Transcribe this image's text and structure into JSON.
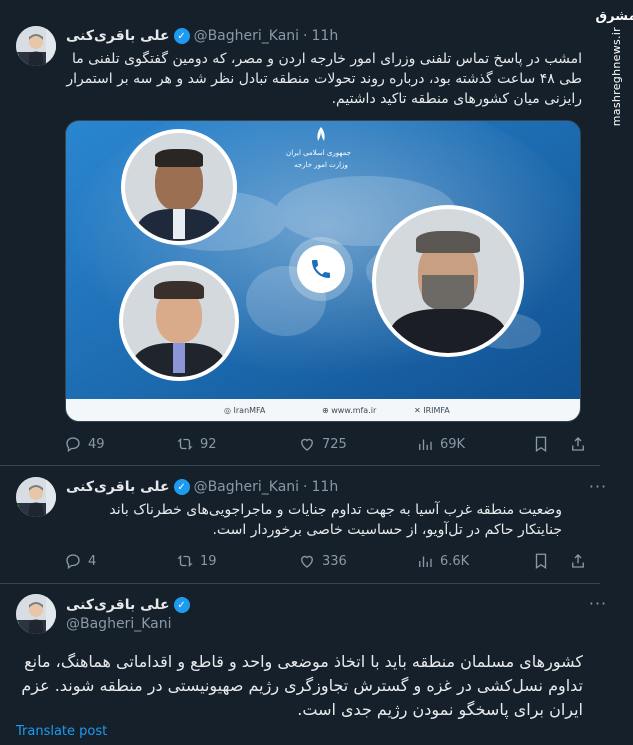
{
  "brand": {
    "logo": "مشرق",
    "url": "mashreghnews.ir"
  },
  "tweets": [
    {
      "name": "علی باقری‌کنی",
      "handle": "@Bagheri_Kani",
      "time": "11h",
      "text": "امشب در پاسخ تماس تلفنی وزرای امور خارجه اردن و مصر، که دومین گفتگوی تلفنی ما طی ۴۸ ساعت گذشته بود، درباره روند تحولات منطقه تبادل نظر شد و هر سه بر استمرار رایزنی میان کشورهای منطقه تاکید داشتیم.",
      "media": {
        "ministry_line1": "جمهوری اسلامی ایران",
        "ministry_line2": "وزارت امور خارجه",
        "footer_left": "IranMFA",
        "footer_mid": "www.mfa.ir",
        "footer_right": "IRIMFA"
      },
      "stats": {
        "replies": "49",
        "reposts": "92",
        "likes": "725",
        "views": "69K"
      }
    },
    {
      "name": "علی باقری‌کنی",
      "handle": "@Bagheri_Kani",
      "time": "11h",
      "text": "وضعیت منطقه غرب آسیا به جهت تداوم جنایات و ماجراجویی‌های خطرناک باند جنایتکار حاکم در تل‌آویو، از حساسیت خاصی برخوردار است.",
      "stats": {
        "replies": "4",
        "reposts": "19",
        "likes": "336",
        "views": "6.6K"
      }
    },
    {
      "name": "علی باقری‌کنی",
      "handle": "@Bagheri_Kani",
      "text": "کشورهای مسلمان منطقه باید با اتخاذ موضعی واحد و قاطع و اقداماتی هماهنگ، مانع تداوم نسل‌کشی در غزه و گسترش تجاوزگری رژیم صهیونیستی در منطقه شوند. عزم ایران برای پاسخگو نمودن رژیم جدی است.",
      "translate": "Translate post"
    }
  ],
  "colors": {
    "background": "#15202b",
    "accent": "#1d9bf0",
    "muted": "#8b98a5",
    "border": "#38444d"
  },
  "icons": [
    "verified-icon",
    "more-icon",
    "reply-icon",
    "repost-icon",
    "like-icon",
    "views-icon",
    "bookmark-icon",
    "share-icon",
    "phone-icon"
  ]
}
